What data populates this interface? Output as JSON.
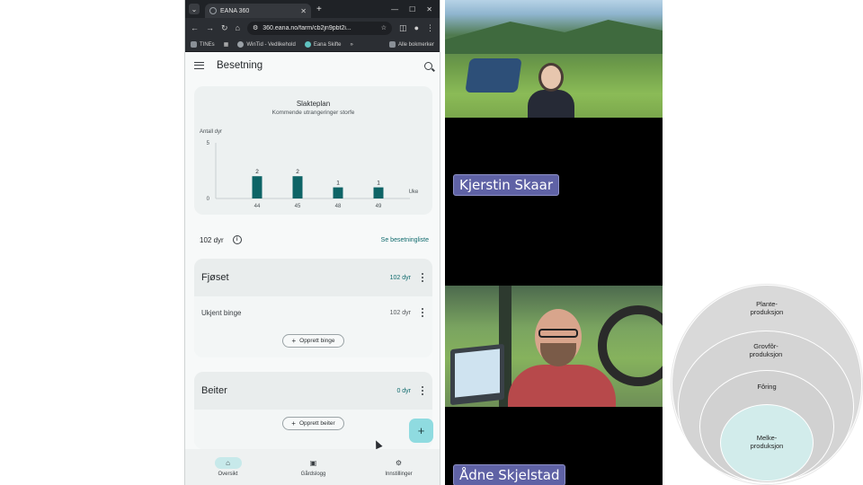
{
  "browser": {
    "tab_title": "EANA 360",
    "url": "360.eana.no/farm/cb2jn9pbt2i...",
    "bookmarks": [
      "TINEs",
      "WinTid - Vedlikehold",
      "Eana Skifte"
    ],
    "bookmarks_all": "Alle bokmerker"
  },
  "app": {
    "title": "Besetning",
    "summary": {
      "count": "102 dyr",
      "link": "Se besetningliste"
    },
    "groups": [
      {
        "name": "Fjøset",
        "count": "102 dyr",
        "rows": [
          {
            "name": "Ukjent binge",
            "count": "102 dyr"
          }
        ],
        "action": "Opprett binge"
      },
      {
        "name": "Beiter",
        "count": "0 dyr",
        "action": "Opprett beiter"
      }
    ],
    "bottom_nav": [
      {
        "label": "Oversikt",
        "icon": "home-icon",
        "active": true
      },
      {
        "label": "Gårdslogg",
        "icon": "calendar-icon",
        "active": false
      },
      {
        "label": "Innstillinger",
        "icon": "gear-icon",
        "active": false
      }
    ],
    "accent": "#0f6a6d"
  },
  "chart_data": {
    "type": "bar",
    "title": "Slakteplan",
    "subtitle": "Kommende utrangeringer storfe",
    "ylabel": "Antall dyr",
    "xlabel": "Uke",
    "categories": [
      "44",
      "45",
      "48",
      "49"
    ],
    "values": [
      2,
      2,
      1,
      1
    ],
    "ylim": [
      0,
      5
    ],
    "yticks": [
      0,
      5
    ],
    "bar_color": "#0e6466"
  },
  "participants": [
    "Kjerstin Skaar",
    "Ådne Skjelstad"
  ],
  "diagram": {
    "levels": [
      "Plante-\nproduksjon",
      "Grovfôr-\nproduksjon",
      "Fôring",
      "Melke-\nproduksjon"
    ]
  }
}
